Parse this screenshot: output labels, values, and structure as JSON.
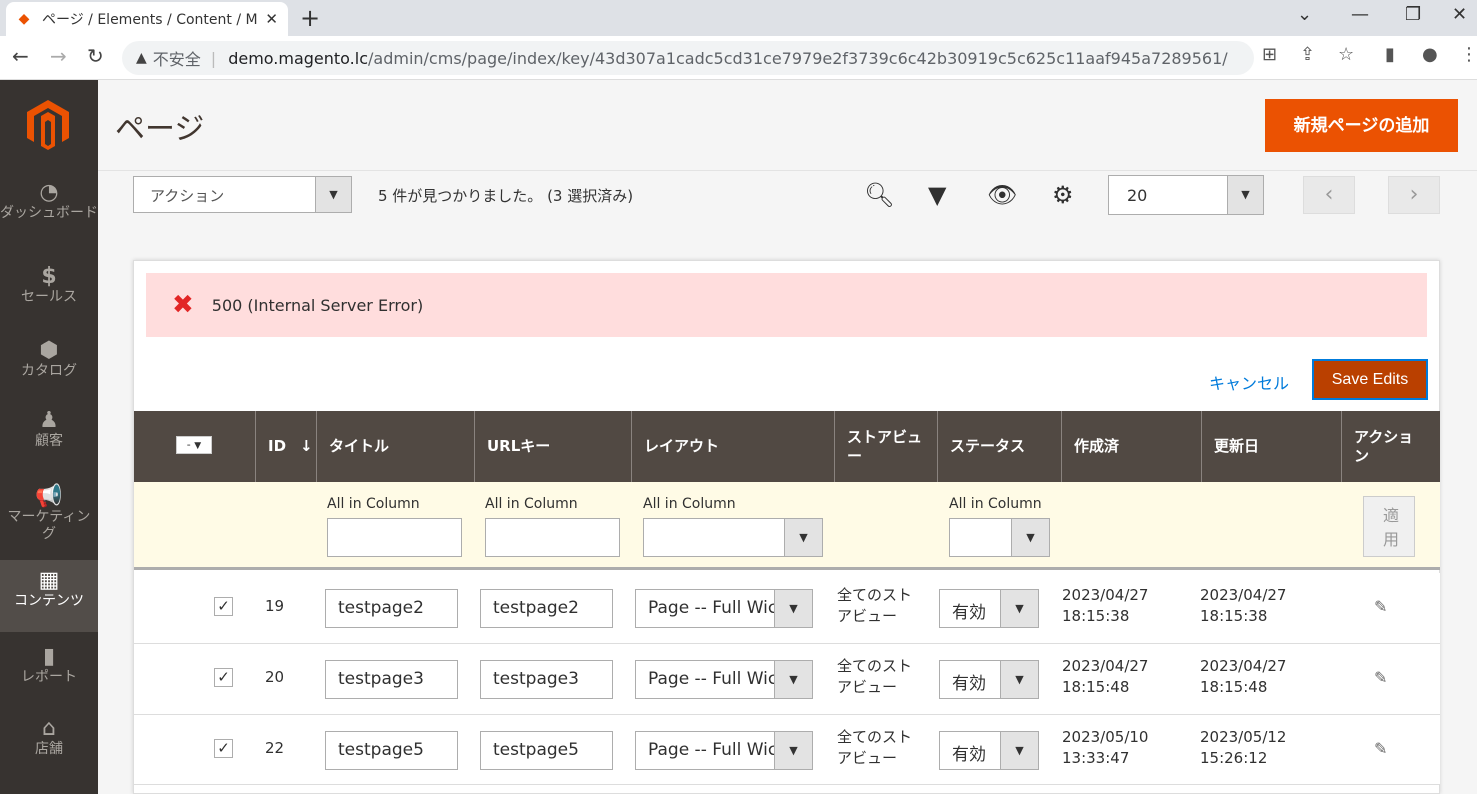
{
  "browser": {
    "tab_title": "ページ / Elements / Content / M",
    "address": {
      "security_label": "不安全",
      "host": "demo.magento.lc",
      "path": "/admin/cms/page/index/key/43d307a1cadc5cd31ce7979e2f3739c6c42b30919c5c625c11aaf945a7289561/"
    }
  },
  "sidebar": {
    "items": [
      {
        "label": "ダッシュボード",
        "icon": "speedometer-icon"
      },
      {
        "label": "セールス",
        "icon": "dollar-icon"
      },
      {
        "label": "カタログ",
        "icon": "box-icon"
      },
      {
        "label": "顧客",
        "icon": "person-icon"
      },
      {
        "label": "マーケティング",
        "icon": "megaphone-icon"
      },
      {
        "label": "コンテンツ",
        "icon": "layout-icon"
      },
      {
        "label": "レポート",
        "icon": "bar-chart-icon"
      },
      {
        "label": "店舗",
        "icon": "store-icon"
      }
    ]
  },
  "page": {
    "title": "ページ",
    "add_button": "新規ページの追加"
  },
  "toolbar": {
    "action_select": "アクション",
    "found_text": "5 件が見つかりました。 (3 選択済み)",
    "per_page": "20"
  },
  "error": {
    "message": "500 (Internal Server Error)"
  },
  "edit_actions": {
    "cancel": "キャンセル",
    "save": "Save Edits"
  },
  "table": {
    "mass_select": "-",
    "headers": {
      "id": "ID",
      "title": "タイトル",
      "url_key": "URLキー",
      "layout": "レイアウト",
      "store_view": "ストアビュー",
      "status": "ステータス",
      "created": "作成済",
      "updated": "更新日",
      "action": "アクション"
    },
    "filters": {
      "title_label": "All in Column",
      "url_label": "All in Column",
      "layout_label": "All in Column",
      "status_label": "All in Column",
      "apply": "適用"
    },
    "rows": [
      {
        "id": "19",
        "title": "testpage2",
        "url_key": "testpage2",
        "layout": "Page -- Full Wic",
        "store_line1": "全てのスト",
        "store_line2": "アビュー",
        "status": "有効",
        "created_date": "2023/04/27",
        "created_time": "18:15:38",
        "updated_date": "2023/04/27",
        "updated_time": "18:15:38"
      },
      {
        "id": "20",
        "title": "testpage3",
        "url_key": "testpage3",
        "layout": "Page -- Full Wic",
        "store_line1": "全てのスト",
        "store_line2": "アビュー",
        "status": "有効",
        "created_date": "2023/04/27",
        "created_time": "18:15:48",
        "updated_date": "2023/04/27",
        "updated_time": "18:15:48"
      },
      {
        "id": "22",
        "title": "testpage5",
        "url_key": "testpage5",
        "layout": "Page -- Full Wic",
        "store_line1": "全てのスト",
        "store_line2": "アビュー",
        "status": "有効",
        "created_date": "2023/05/10",
        "created_time": "13:33:47",
        "updated_date": "2023/05/12",
        "updated_time": "15:26:12"
      }
    ]
  },
  "colors": {
    "accent": "#eb5202",
    "sidebar_bg": "#373330",
    "header_bg": "#514943",
    "error_bg": "#ffdddd",
    "link": "#007bdb"
  }
}
